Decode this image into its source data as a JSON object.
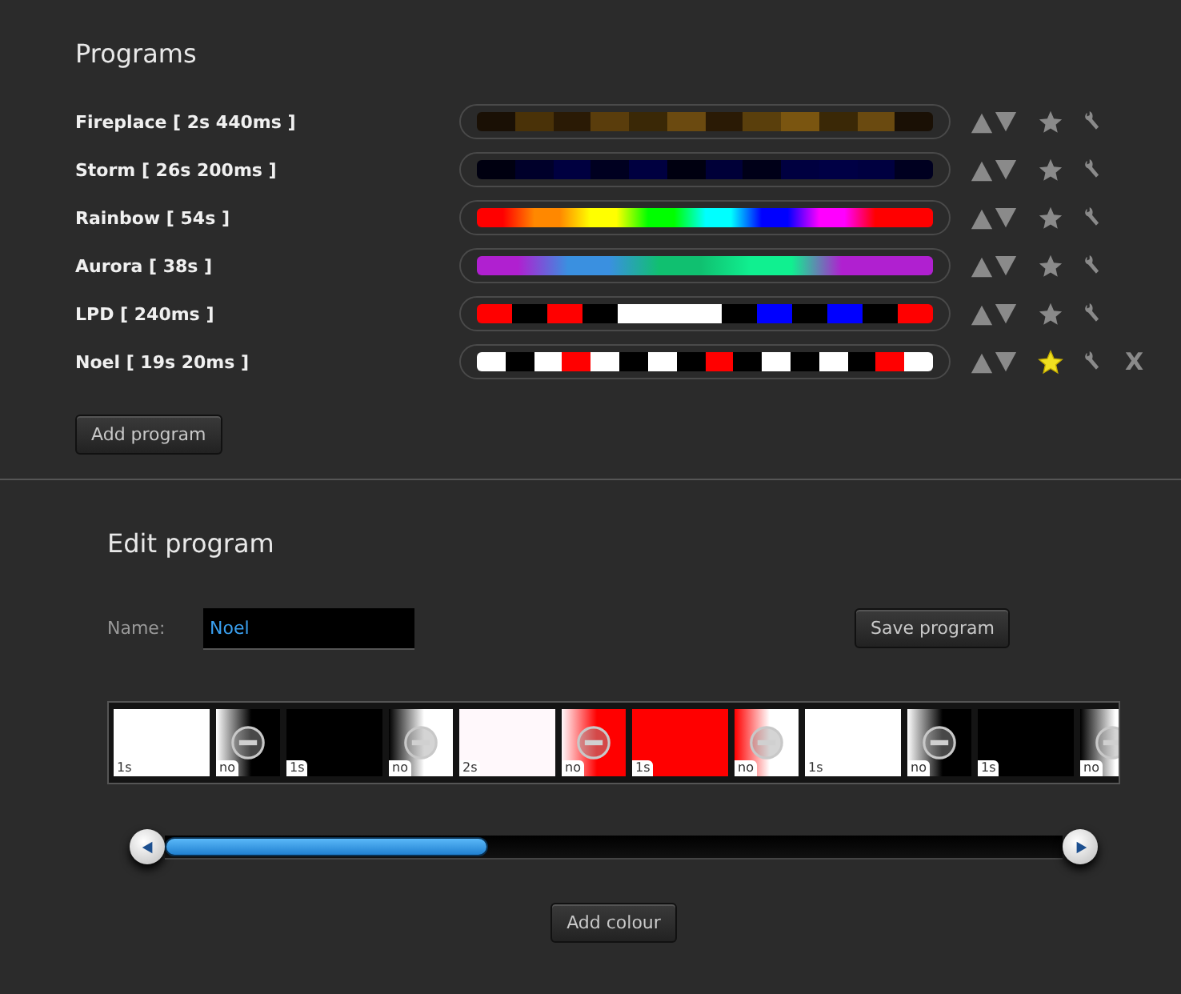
{
  "programs_title": "Programs",
  "programs": [
    {
      "label": "Fireplace [ 2s 440ms ]",
      "kind": "blocks",
      "favourite": false,
      "segments": [
        {
          "color": "#1a1005"
        },
        {
          "color": "#4a3208"
        },
        {
          "color": "#2a1a05"
        },
        {
          "color": "#5a3d0c"
        },
        {
          "color": "#3a2806"
        },
        {
          "color": "#6b4a10"
        },
        {
          "color": "#2a1a05"
        },
        {
          "color": "#5a3f0c"
        },
        {
          "color": "#7a5510"
        },
        {
          "color": "#3a2806"
        },
        {
          "color": "#6a4a10"
        },
        {
          "color": "#1a1005"
        }
      ]
    },
    {
      "label": "Storm [ 26s 200ms ]",
      "kind": "blocks",
      "favourite": false,
      "segments": [
        {
          "color": "#000010"
        },
        {
          "color": "#00002a"
        },
        {
          "color": "#000040"
        },
        {
          "color": "#000020"
        },
        {
          "color": "#000040"
        },
        {
          "color": "#000010"
        },
        {
          "color": "#000038"
        },
        {
          "color": "#000018"
        },
        {
          "color": "#000040"
        },
        {
          "color": "#000045"
        },
        {
          "color": "#000040"
        },
        {
          "color": "#000020"
        }
      ]
    },
    {
      "label": "Rainbow [ 54s ]",
      "kind": "smooth",
      "favourite": false,
      "segments": [
        {
          "color": "#ff0000"
        },
        {
          "color": "#ff8800"
        },
        {
          "color": "#ffff00"
        },
        {
          "color": "#00ff00"
        },
        {
          "color": "#00ffff"
        },
        {
          "color": "#0000ff"
        },
        {
          "color": "#ff00ff"
        },
        {
          "color": "#ff0000"
        }
      ]
    },
    {
      "label": "Aurora [ 38s ]",
      "kind": "smooth",
      "favourite": false,
      "segments": [
        {
          "color": "#b020d0"
        },
        {
          "color": "#3a90e0"
        },
        {
          "color": "#10c070"
        },
        {
          "color": "#10f090"
        },
        {
          "color": "#b020d0"
        }
      ]
    },
    {
      "label": "LPD [ 240ms ]",
      "kind": "blocks",
      "favourite": false,
      "segments": [
        {
          "color": "#ff0000"
        },
        {
          "color": "#000000"
        },
        {
          "color": "#ff0000"
        },
        {
          "color": "#000000"
        },
        {
          "color": "#ffffff"
        },
        {
          "color": "#ffffff"
        },
        {
          "color": "#ffffff"
        },
        {
          "color": "#000000"
        },
        {
          "color": "#0000ff"
        },
        {
          "color": "#000000"
        },
        {
          "color": "#0000ff"
        },
        {
          "color": "#000000"
        },
        {
          "color": "#ff0000"
        }
      ]
    },
    {
      "label": "Noel [ 19s 20ms ]",
      "kind": "blocks",
      "favourite": true,
      "delete": "X",
      "segments": [
        {
          "color": "#ffffff"
        },
        {
          "color": "#000000"
        },
        {
          "color": "#ffffff"
        },
        {
          "color": "#ff0000"
        },
        {
          "color": "#ffffff"
        },
        {
          "color": "#000000"
        },
        {
          "color": "#ffffff"
        },
        {
          "color": "#000000"
        },
        {
          "color": "#ff0000"
        },
        {
          "color": "#000000"
        },
        {
          "color": "#ffffff"
        },
        {
          "color": "#000000"
        },
        {
          "color": "#ffffff"
        },
        {
          "color": "#000000"
        },
        {
          "color": "#ff0000"
        },
        {
          "color": "#ffffff"
        }
      ]
    }
  ],
  "add_program": "Add program",
  "edit_title": "Edit program",
  "name_label": "Name:",
  "name_value": "Noel",
  "save": "Save program",
  "steps": [
    {
      "kind": "colour",
      "label": "1s",
      "color": "#ffffff"
    },
    {
      "kind": "fade",
      "label": "no",
      "color": "#000000"
    },
    {
      "kind": "colour",
      "label": "1s",
      "color": "#000000"
    },
    {
      "kind": "fade",
      "label": "no",
      "color": "#ffffff"
    },
    {
      "kind": "colour",
      "label": "2s",
      "color": "#fff8fb"
    },
    {
      "kind": "fade",
      "label": "no",
      "color": "#ff0000"
    },
    {
      "kind": "colour",
      "label": "1s",
      "color": "#ff0000"
    },
    {
      "kind": "fade",
      "label": "no",
      "color": "#ffffff"
    },
    {
      "kind": "colour",
      "label": "1s",
      "color": "#ffffff"
    },
    {
      "kind": "fade",
      "label": "no",
      "color": "#000000"
    },
    {
      "kind": "colour",
      "label": "1s",
      "color": "#000000"
    },
    {
      "kind": "fade",
      "label": "no",
      "color": "#ffffff"
    }
  ],
  "scroll": {
    "level": 0.36
  },
  "add_colour": "Add colour"
}
